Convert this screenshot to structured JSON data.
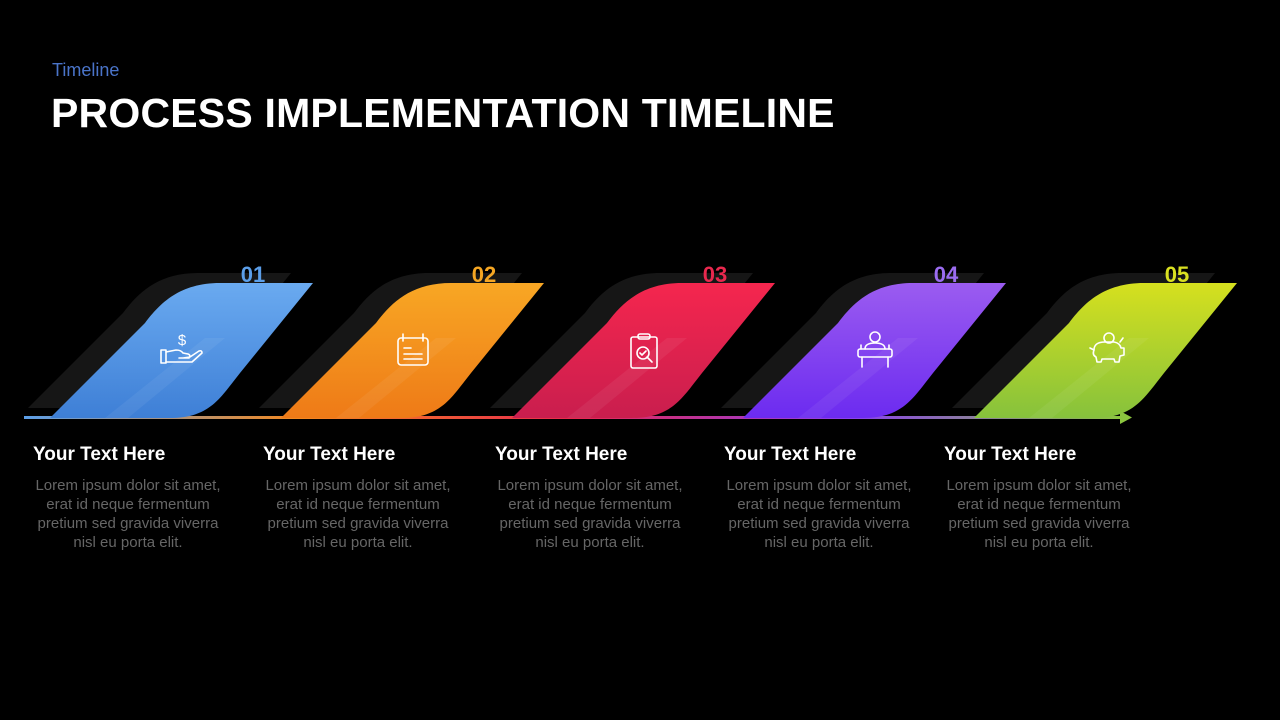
{
  "header": {
    "subtitle": "Timeline",
    "title": "PROCESS IMPLEMENTATION TIMELINE"
  },
  "timeline": {
    "axis_colors": [
      "#5b9ee8",
      "#f5891f",
      "#e8284e",
      "#8a3ff0",
      "#8cc63f"
    ],
    "steps": [
      {
        "number": "01",
        "icon": "hand-dollar-icon",
        "color_top": "#6aaaf0",
        "color_bottom": "#3e7fd6",
        "number_color": "#5b9ee8",
        "heading": "Your  Text Here",
        "body": "Lorem ipsum dolor sit amet, erat id neque fermentum  pretium sed gravida viverra nisl eu porta elit."
      },
      {
        "number": "02",
        "icon": "calendar-notes-icon",
        "color_top": "#f8a724",
        "color_bottom": "#ee7a17",
        "number_color": "#f5a623",
        "heading": "Your  Text Here",
        "body": "Lorem ipsum dolor sit amet, erat id neque fermentum  pretium sed gravida viverra nisl eu porta elit."
      },
      {
        "number": "03",
        "icon": "clipboard-search-icon",
        "color_top": "#f5264e",
        "color_bottom": "#c91e4e",
        "number_color": "#e8284e",
        "heading": "Your  Text Here",
        "body": "Lorem ipsum dolor sit amet, erat id neque fermentum  pretium sed gravida viverra nisl eu porta elit."
      },
      {
        "number": "04",
        "icon": "person-desk-icon",
        "color_top": "#9b5cf0",
        "color_bottom": "#6c2bf0",
        "number_color": "#9b6cf0",
        "heading": "Your  Text Here",
        "body": "Lorem ipsum dolor sit amet, erat id neque fermentum  pretium sed gravida viverra nisl eu porta elit."
      },
      {
        "number": "05",
        "icon": "piggy-bank-icon",
        "color_top": "#d6e01e",
        "color_bottom": "#86c23c",
        "number_color": "#d9e021",
        "heading": "Your  Text Here",
        "body": "Lorem ipsum dolor sit amet, erat id neque fermentum  pretium sed gravida viverra nisl eu porta elit."
      }
    ]
  }
}
